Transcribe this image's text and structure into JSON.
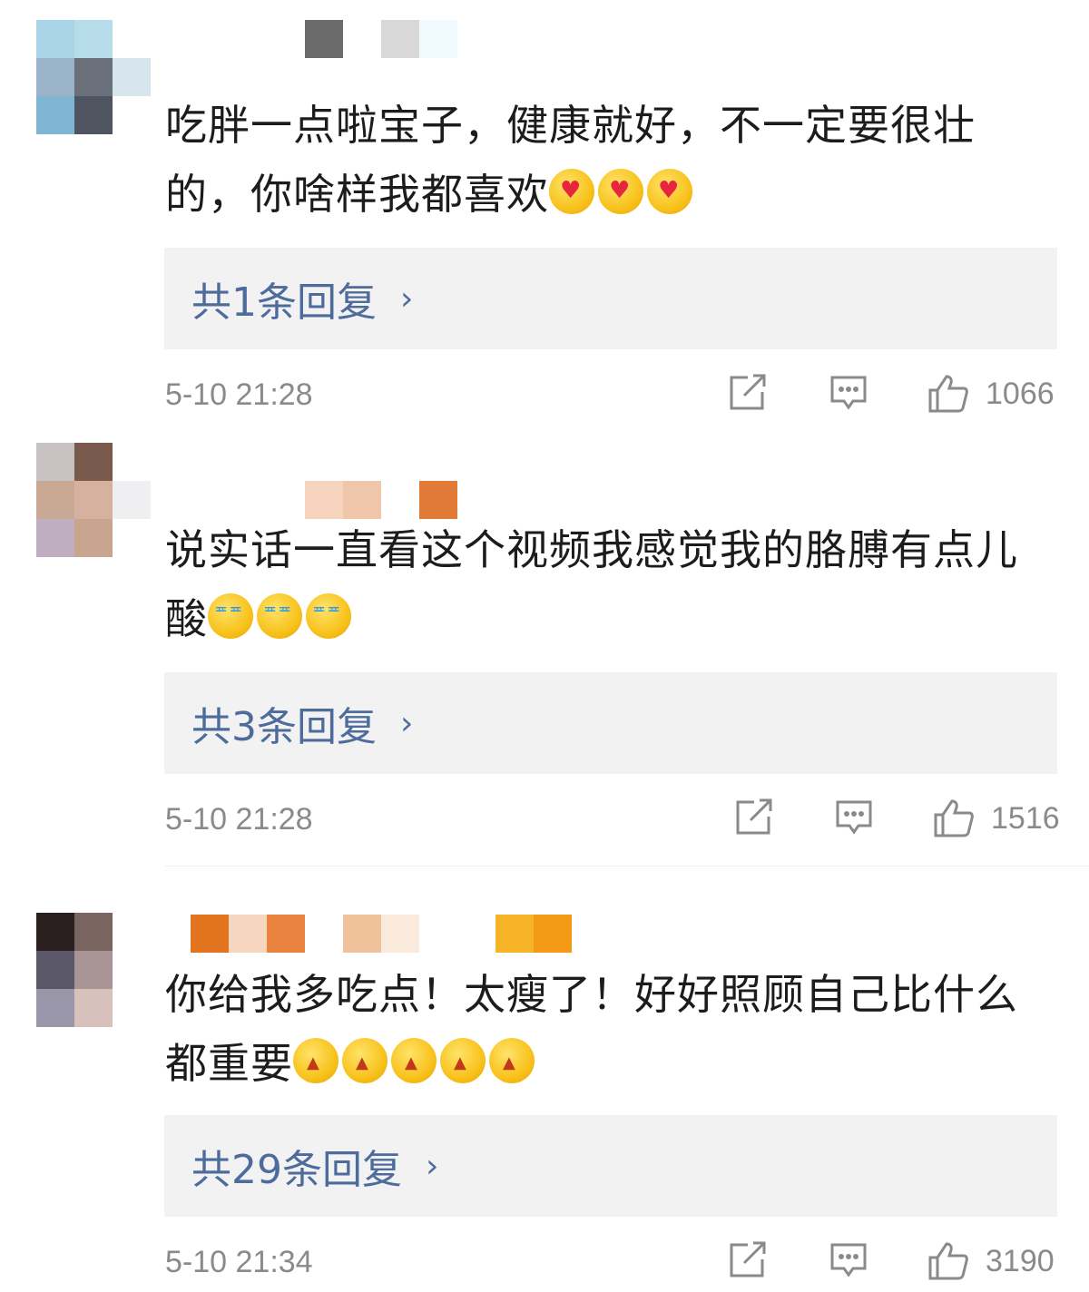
{
  "comments": [
    {
      "text": "吃胖一点啦宝子，健康就好，不一定要很壮的，你啥样我都喜欢",
      "emoji": "heart-face-icon",
      "reply_label": "共1条回复",
      "time": "5-10 21:28",
      "likes": "1066"
    },
    {
      "text": "说实话一直看这个视频我感觉我的胳膊有点儿酸",
      "emoji": "crying-laughing-icon",
      "reply_label": "共3条回复",
      "time": "5-10 21:28",
      "likes": "1516"
    },
    {
      "text": "你给我多吃点！太瘦了！好好照顾自己比什么都重要",
      "emoji": "angry-face-icon",
      "reply_label": "共29条回复",
      "time": "5-10 21:34",
      "likes": "3190"
    }
  ],
  "icons": {
    "reply_chevron": "chevron-right-icon",
    "share": "share-icon",
    "comment": "comment-icon",
    "like": "thumbs-up-icon"
  },
  "colors": {
    "link": "#4d6c9c",
    "meta": "#8a8a8a",
    "reply_bg": "#f2f2f2"
  }
}
